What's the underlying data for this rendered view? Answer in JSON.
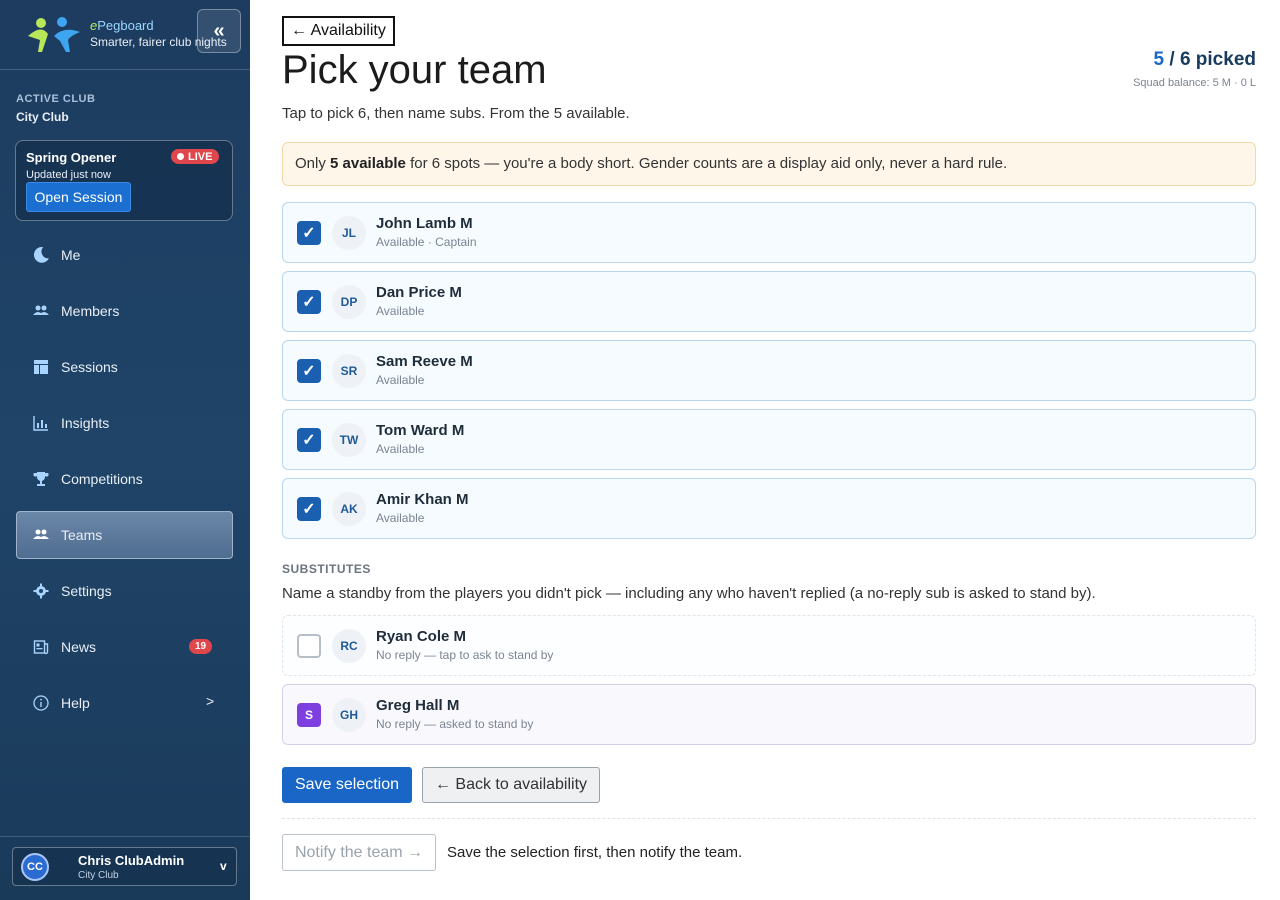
{
  "brand": {
    "name_prefix": "e",
    "name": "Pegboard",
    "tagline": "Smarter, fairer club nights",
    "collapse_label": "«"
  },
  "club": {
    "label": "ACTIVE CLUB",
    "name": "City Club"
  },
  "session": {
    "title": "Spring Opener",
    "live_label": "LIVE",
    "updated": "Updated just now",
    "open_label": "Open Session"
  },
  "nav": {
    "items": [
      {
        "label": "Me",
        "icon": "moon-icon"
      },
      {
        "label": "Members",
        "icon": "members-icon"
      },
      {
        "label": "Sessions",
        "icon": "sessions-icon"
      },
      {
        "label": "Insights",
        "icon": "chart-icon"
      },
      {
        "label": "Competitions",
        "icon": "trophy-icon"
      },
      {
        "label": "Teams",
        "icon": "teams-icon",
        "active": true
      },
      {
        "label": "Settings",
        "icon": "gear-icon"
      },
      {
        "label": "News",
        "icon": "news-icon",
        "badge": "19"
      },
      {
        "label": "Help",
        "icon": "info-icon",
        "chevron": ">"
      }
    ]
  },
  "user": {
    "initials": "CC",
    "name": "Chris ClubAdmin",
    "club": "City Club",
    "chevron": "v"
  },
  "page": {
    "back_label": "← Availability",
    "title": "Pick your team",
    "picked_count": "5",
    "picked_sep": " / ",
    "picked_total": "6",
    "picked_suffix": " picked",
    "balance": "Squad balance: 5 M · 0 L",
    "intro": "Tap to pick 6, then name subs. From the 5 available."
  },
  "alert": {
    "prefix": "Only ",
    "bold": "5 available",
    "suffix": " for 6 spots — you're a body short. Gender counts are a display aid only, never a hard rule."
  },
  "players": [
    {
      "initials": "JL",
      "name": "John Lamb M",
      "status": "Available · Captain",
      "checked": "✓"
    },
    {
      "initials": "DP",
      "name": "Dan Price M",
      "status": "Available",
      "checked": "✓"
    },
    {
      "initials": "SR",
      "name": "Sam Reeve M",
      "status": "Available",
      "checked": "✓"
    },
    {
      "initials": "TW",
      "name": "Tom Ward M",
      "status": "Available",
      "checked": "✓"
    },
    {
      "initials": "AK",
      "name": "Amir Khan M",
      "status": "Available",
      "checked": "✓"
    }
  ],
  "substitutes": {
    "heading": "SUBSTITUTES",
    "description": "Name a standby from the players you didn't pick — including any who haven't replied (a no-reply sub is asked to stand by).",
    "items": [
      {
        "initials": "RC",
        "name": "Ryan Cole M",
        "status": "No reply — tap to ask to stand by",
        "mark": ""
      },
      {
        "initials": "GH",
        "name": "Greg Hall M",
        "status": "No reply — asked to stand by",
        "mark": "S"
      }
    ]
  },
  "actions": {
    "save_label": "Save selection",
    "back_label": "← Back to availability",
    "notify_label": "Notify the team →",
    "notify_hint": "Save the selection first, then notify the team."
  }
}
